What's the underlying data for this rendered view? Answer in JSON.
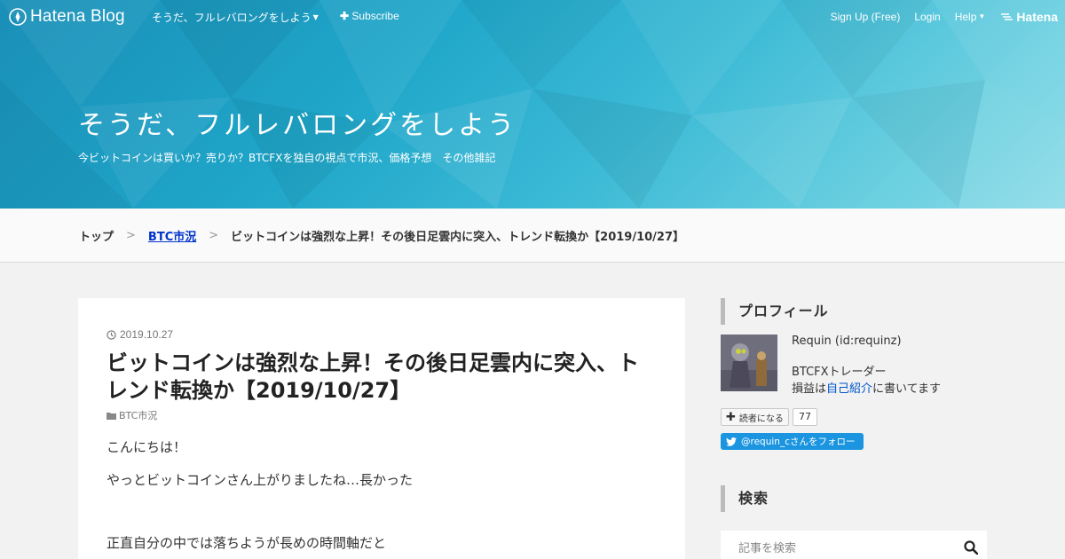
{
  "globalbar": {
    "brand": "Hatena Blog",
    "blog_menu": "そうだ、フルレバロングをしよう",
    "subscribe": "Subscribe",
    "signup": "Sign Up (Free)",
    "login": "Login",
    "help": "Help",
    "hatena": "Hatena"
  },
  "header": {
    "title": "そうだ、フルレバロングをしよう",
    "description": "今ビットコインは買いか？売りか？BTCFXを独自の視点で市況、価格予想　その他雑記"
  },
  "breadcrumb": {
    "items": [
      "トップ",
      "BTC市況",
      "ビットコインは強烈な上昇！その後日足雲内に突入、トレンド転換か【2019/10/27】"
    ],
    "separator": ">"
  },
  "article": {
    "date": "2019.10.27",
    "title": "ビットコインは強烈な上昇！その後日足雲内に突入、トレンド転換か【2019/10/27】",
    "category": "BTC市況",
    "paragraphs": [
      "こんにちは！",
      "やっとビットコインさん上がりましたね…長かった",
      "正直自分の中では落ちようが長めの時間軸だと"
    ]
  },
  "sidebar": {
    "profile_heading": "プロフィール",
    "profile_name": "Requin (id:requinz)",
    "profile_role": "BTCFXトレーダー",
    "profile_note_before": "損益は",
    "profile_note_link": "自己紹介",
    "profile_note_after": "に書いてます",
    "reader_button": "読者になる",
    "reader_count": "77",
    "twitter_follow": "@requin_cさんをフォロー",
    "search_heading": "検索",
    "search_placeholder": "記事を検索"
  },
  "colors": {
    "link": "#0033cc",
    "twitter": "#1b95e0",
    "header_gradient_start": "#1a8fb8",
    "header_gradient_end": "#8adbe8"
  },
  "icons": {
    "brand": "hatena-blog-pen-icon",
    "subscribe": "plus-icon",
    "date": "clock-icon",
    "category": "folder-icon",
    "twitter": "twitter-bird-icon",
    "search": "magnifier-icon"
  }
}
